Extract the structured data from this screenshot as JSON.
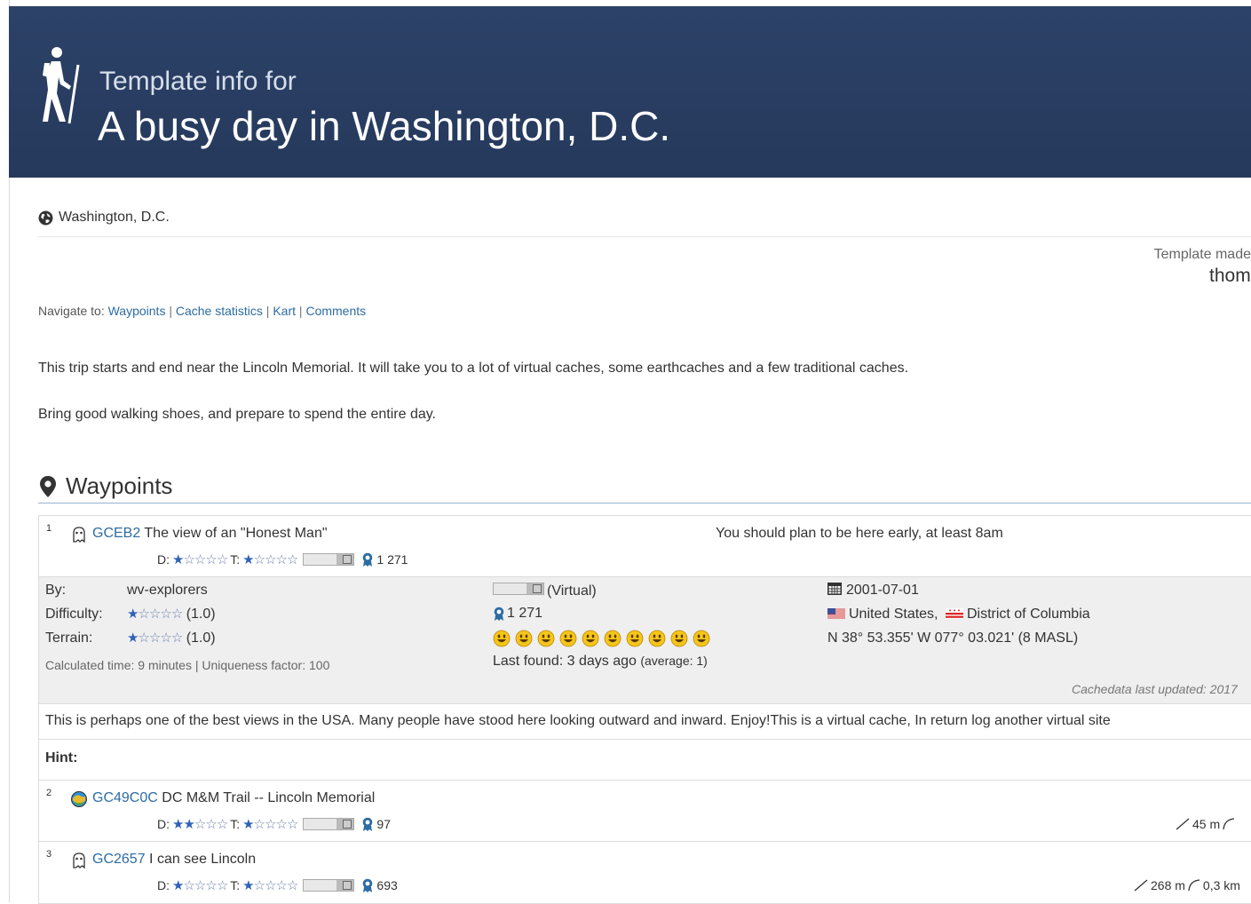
{
  "banner": {
    "subtitle": "Template info for",
    "title": "A busy day in Washington, D.C."
  },
  "location": "Washington, D.C.",
  "template_made": "Template made",
  "author": "thom",
  "nav": {
    "prefix": "Navigate to:",
    "links": [
      "Waypoints",
      "Cache statistics",
      "Kart",
      "Comments"
    ]
  },
  "paragraphs": [
    "This trip starts and end near the Lincoln Memorial. It will take you to a lot of virtual caches, some earthcaches and a few traditional caches.",
    "Bring good walking shoes, and prepare to spend the entire day."
  ],
  "waypoints_heading": "Waypoints",
  "waypoints": [
    {
      "number": "1",
      "code": "GCEB2",
      "name": "The view of an \"Honest Man\"",
      "icon": "virtual-cache-icon",
      "difficulty_stars": 1,
      "terrain_stars": 1,
      "favorites": "1 271",
      "note": "You should plan to be here early, at least 8am",
      "details": {
        "by_label": "By:",
        "by": "wv-explorers",
        "difficulty_label": "Difficulty:",
        "difficulty": "(1.0)",
        "terrain_label": "Terrain:",
        "terrain": "(1.0)",
        "calc": "Calculated time: 9 minutes | Uniqueness factor: 100",
        "size": "(Virtual)",
        "favorites": "1 271",
        "smiley_count": 10,
        "last_found": "Last found: 3 days ago",
        "last_found_avg": "(average: 1)",
        "date": "2001-07-01",
        "country": "United States,",
        "region": "District of Columbia",
        "coords": "N 38° 53.355' W 077° 03.021' (8 MASL)",
        "updated": "Cachedata last updated: 2017"
      },
      "description": "This is perhaps one of the best views in the USA. Many people have stood here looking outward and inward. Enjoy!This is a virtual cache, In return log another virtual site",
      "hint_label": "Hint:"
    },
    {
      "number": "2",
      "code": "GC49C0C",
      "name": "DC M&M Trail -- Lincoln Memorial",
      "icon": "earthcache-icon",
      "difficulty_stars": 2,
      "terrain_stars": 1,
      "favorites": "97",
      "distance": "45 m"
    },
    {
      "number": "3",
      "code": "GC2657",
      "name": "I can see Lincoln",
      "icon": "virtual-cache-icon",
      "difficulty_stars": 1,
      "terrain_stars": 1,
      "favorites": "693",
      "distance": "268 m",
      "route": "0,3 km"
    }
  ],
  "labels": {
    "d": "D:",
    "t": "T:"
  },
  "colors": {
    "banner": "#2c4166",
    "link": "#2d6ca2",
    "star": "#2f62b6",
    "panel_bg": "#efefef"
  }
}
